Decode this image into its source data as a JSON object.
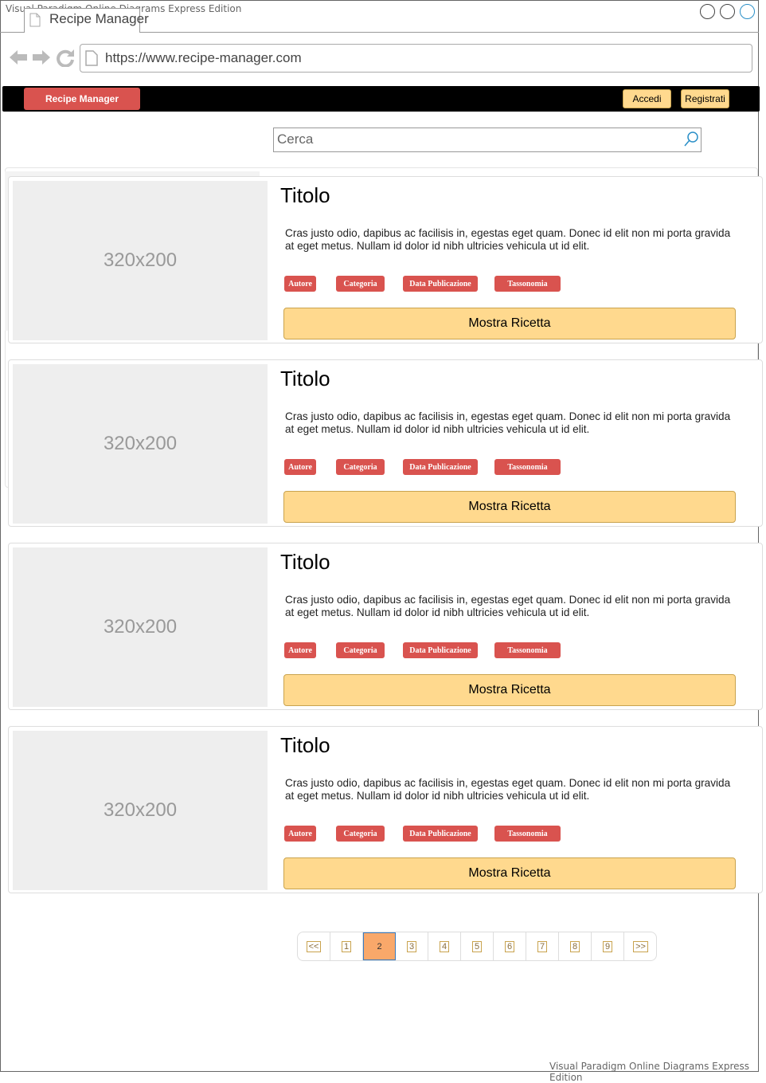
{
  "watermark_top": "Visual Paradigm Online Diagrams Express Edition",
  "watermark_bottom": "Visual Paradigm Online Diagrams Express Edition",
  "browser": {
    "tab_title": "Recipe Manager",
    "url": "https://www.recipe-manager.com"
  },
  "navbar": {
    "brand": "Recipe Manager",
    "login": "Accedi",
    "register": "Registrati"
  },
  "search": {
    "placeholder": "Cerca"
  },
  "cards": [
    {
      "image": "320x200",
      "title": "Titolo",
      "description": "Cras justo odio, dapibus ac facilisis in, egestas eget quam. Donec id elit non mi porta gravida at eget metus. Nullam id dolor id nibh ultricies vehicula ut id elit.",
      "tags": [
        "Autore",
        "Categoria",
        "Data Publicazione",
        "Tassonomia"
      ],
      "button": "Mostra Ricetta"
    },
    {
      "image": "320x200",
      "title": "Titolo",
      "description": "Cras justo odio, dapibus ac facilisis in, egestas eget quam. Donec id elit non mi porta gravida at eget metus. Nullam id dolor id nibh ultricies vehicula ut id elit.",
      "tags": [
        "Autore",
        "Categoria",
        "Data Publicazione",
        "Tassonomia"
      ],
      "button": "Mostra Ricetta"
    },
    {
      "image": "320x200",
      "title": "Titolo",
      "description": "Cras justo odio, dapibus ac facilisis in, egestas eget quam. Donec id elit non mi porta gravida at eget metus. Nullam id dolor id nibh ultricies vehicula ut id elit.",
      "tags": [
        "Autore",
        "Categoria",
        "Data Publicazione",
        "Tassonomia"
      ],
      "button": "Mostra Ricetta"
    },
    {
      "image": "320x200",
      "title": "Titolo",
      "description": "Cras justo odio, dapibus ac facilisis in, egestas eget quam. Donec id elit non mi porta gravida at eget metus. Nullam id dolor id nibh ultricies vehicula ut id elit.",
      "tags": [
        "Autore",
        "Categoria",
        "Data Publicazione",
        "Tassonomia"
      ],
      "button": "Mostra Ricetta"
    }
  ],
  "pagination": {
    "prev": "<<",
    "pages": [
      "1",
      "2",
      "3",
      "4",
      "5",
      "6",
      "7",
      "8",
      "9"
    ],
    "next": ">>",
    "current": "2"
  },
  "colors": {
    "navbar": "#000000",
    "brand": "#d9534f",
    "button": "#ffd98e",
    "tag": "#d9534f",
    "active_page": "#f9a86a"
  }
}
